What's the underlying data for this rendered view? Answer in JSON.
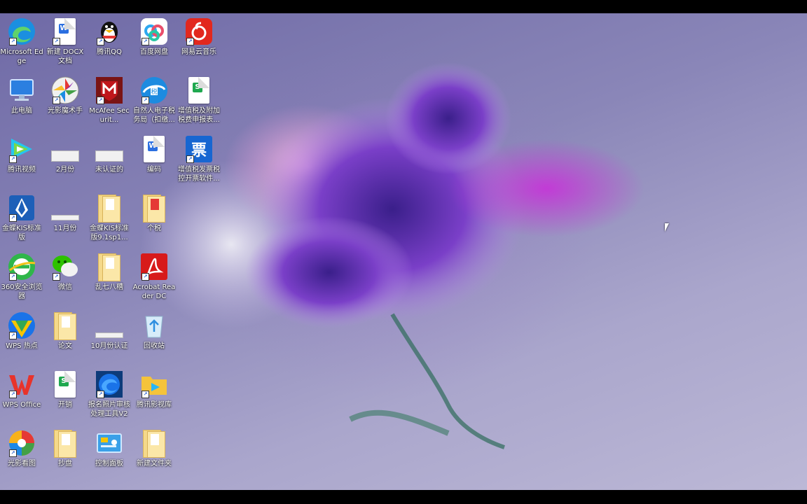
{
  "desktop": {
    "icons": [
      {
        "id": "edge",
        "label": "Microsoft Edge",
        "icon": "edge-icon"
      },
      {
        "id": "docx",
        "label": "新建 DOCX 文档",
        "icon": "word-doc-icon"
      },
      {
        "id": "qq",
        "label": "腾讯QQ",
        "icon": "qq-penguin-icon"
      },
      {
        "id": "baidupan",
        "label": "百度网盘",
        "icon": "baidu-netdisk-icon"
      },
      {
        "id": "netease",
        "label": "网易云音乐",
        "icon": "netease-music-icon"
      },
      {
        "id": "thispc",
        "label": "此电脑",
        "icon": "computer-icon"
      },
      {
        "id": "guangying",
        "label": "光影魔术手",
        "icon": "aperture-icon"
      },
      {
        "id": "mcafee",
        "label": "McAfee Securit...",
        "icon": "mcafee-shield-icon"
      },
      {
        "id": "ziranren",
        "label": "自然人电子税务局（扣缴...",
        "icon": "tax-bureau-icon"
      },
      {
        "id": "zengzhishui",
        "label": "增值税及附加税费申报表...",
        "icon": "spreadsheet-icon"
      },
      {
        "id": "tencentvideo",
        "label": "腾讯视频",
        "icon": "tencent-video-icon"
      },
      {
        "id": "feb",
        "label": "2月份",
        "icon": "flat-file-icon"
      },
      {
        "id": "weirenzheng",
        "label": "未认证的",
        "icon": "flat-file-icon"
      },
      {
        "id": "bianma",
        "label": "编码",
        "icon": "word-doc-icon"
      },
      {
        "id": "fapiao",
        "label": "增值税发票税控开票软件...",
        "icon": "invoice-icon"
      },
      {
        "id": "kis",
        "label": "金蝶KIS标准版",
        "icon": "kingdee-pen-icon"
      },
      {
        "id": "nov",
        "label": "11月份",
        "icon": "flat-file-icon"
      },
      {
        "id": "kisfolder",
        "label": "金蝶KIS标准版9.1sp1...",
        "icon": "folder-icon"
      },
      {
        "id": "geshui",
        "label": "个税",
        "icon": "folder-icon"
      },
      {
        "id": "browser360",
        "label": "360安全浏览器",
        "icon": "browser-360-icon"
      },
      {
        "id": "wechat",
        "label": "微信",
        "icon": "wechat-icon"
      },
      {
        "id": "luanqi",
        "label": "乱七八糟",
        "icon": "folder-icon"
      },
      {
        "id": "acrobat",
        "label": "Acrobat Reader DC",
        "icon": "acrobat-icon"
      },
      {
        "id": "wpshot",
        "label": "WPS 热点",
        "icon": "wps-hotspot-icon"
      },
      {
        "id": "lunwen",
        "label": "论文",
        "icon": "folder-icon"
      },
      {
        "id": "oct",
        "label": "10月份认证",
        "icon": "flat-file-icon"
      },
      {
        "id": "recycle",
        "label": "回收站",
        "icon": "recycle-bin-icon"
      },
      {
        "id": "wpsoffice",
        "label": "WPS Office",
        "icon": "wps-office-icon"
      },
      {
        "id": "kaixiao",
        "label": "开销",
        "icon": "spreadsheet-icon"
      },
      {
        "id": "baoming",
        "label": "报名照片审核处理工具V2",
        "icon": "photo-tool-icon"
      },
      {
        "id": "tencentlib",
        "label": "腾讯影视库",
        "icon": "video-folder-icon"
      },
      {
        "id": "kanjutu",
        "label": "光影看图",
        "icon": "photo-viewer-icon"
      },
      {
        "id": "chaopan",
        "label": "抄盘",
        "icon": "folder-icon"
      },
      {
        "id": "control",
        "label": "控制面板",
        "icon": "control-panel-icon"
      },
      {
        "id": "newfolder",
        "label": "新建文件夹",
        "icon": "folder-icon"
      }
    ]
  }
}
